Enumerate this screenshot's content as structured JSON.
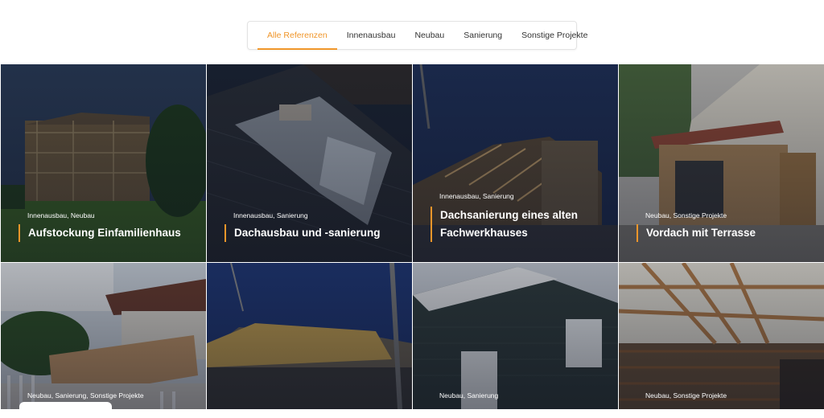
{
  "filters": {
    "tabs": [
      "Alle Referenzen",
      "Innenausbau",
      "Neubau",
      "Sanierung",
      "Sonstige Projekte"
    ],
    "active_index": 0
  },
  "projects": [
    {
      "tags": "Innenausbau, Neubau",
      "title_lines": [
        "Aufstockung Einfamilienhaus"
      ]
    },
    {
      "tags": "Innenausbau, Sanierung",
      "title_lines": [
        "Dachausbau und -sanierung"
      ]
    },
    {
      "tags": "Innenausbau, Sanierung",
      "title_lines": [
        "Dachsanierung eines alten",
        "Fachwerkhauses"
      ]
    },
    {
      "tags": "Neubau, Sonstige Projekte",
      "title_lines": [
        "Vordach mit Terrasse"
      ]
    },
    {
      "tags": "Neubau, Sanierung, Sonstige Projekte",
      "title_lines": []
    },
    {
      "tags": "",
      "title_lines": []
    },
    {
      "tags": "Neubau, Sanierung",
      "title_lines": []
    },
    {
      "tags": "Neubau, Sonstige Projekte",
      "title_lines": []
    }
  ],
  "colors": {
    "accent": "#f0962a"
  }
}
